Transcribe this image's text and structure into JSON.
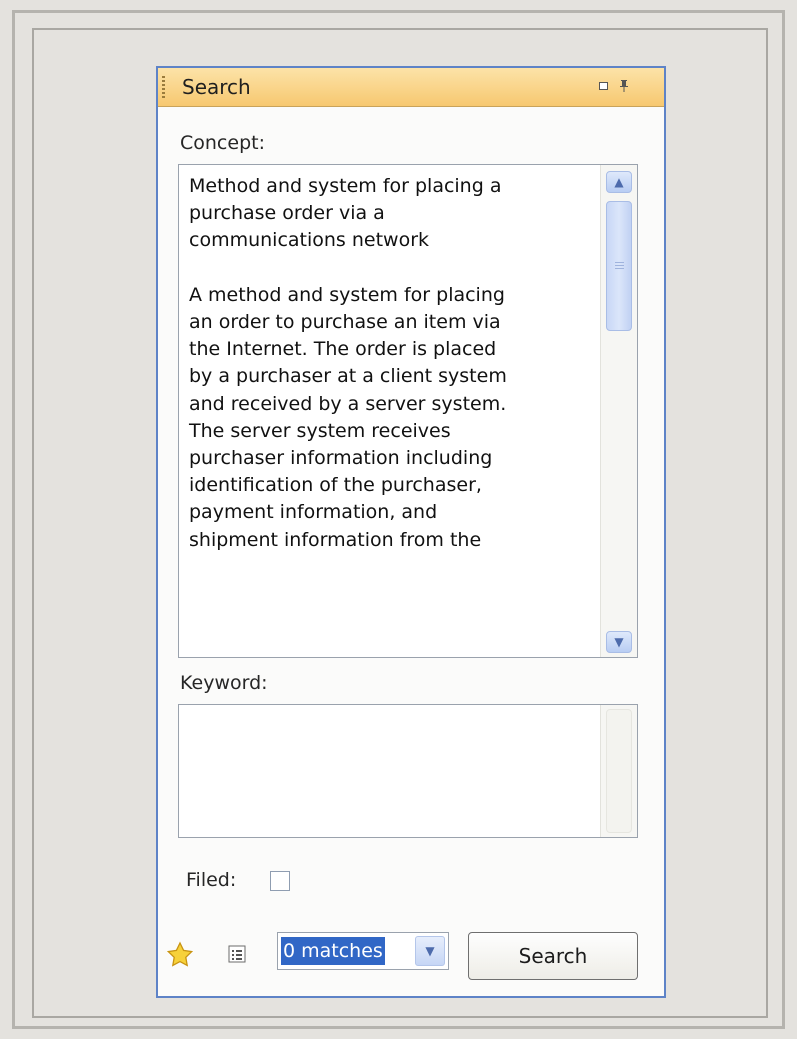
{
  "panel": {
    "title": "Search",
    "restore_glyph": "",
    "pin_glyph": "ᵽ"
  },
  "concept": {
    "label": "Concept:",
    "value": "Method and system for placing a\npurchase order via a\ncommunications network\n\nA method and system for placing\nan order to purchase an item via\nthe Internet. The order is placed\nby a purchaser at a client system\nand received by a server system.\nThe server system receives\npurchaser information including\nidentification of the purchaser,\npayment information, and\nshipment information from the"
  },
  "keyword": {
    "label": "Keyword:",
    "value": ""
  },
  "filed": {
    "label": "Filed:",
    "checked": false
  },
  "footer": {
    "favorite_icon": "star-icon",
    "list_icon": "list-view-icon",
    "matches": "0 matches",
    "search_label": "Search"
  },
  "colors": {
    "title_gradient_top": "#fce3a8",
    "title_gradient_bottom": "#f7c870",
    "panel_border": "#5e83c7",
    "selection": "#3167c6"
  }
}
